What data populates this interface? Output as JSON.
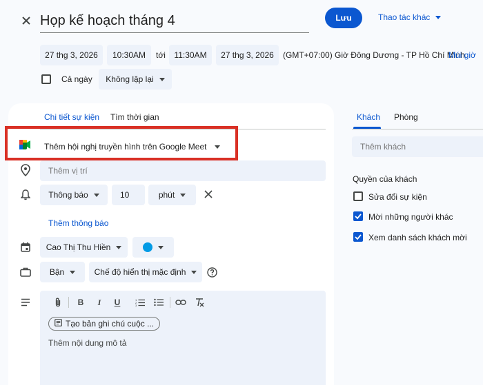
{
  "header": {
    "title": "Họp kế hoạch tháng 4",
    "save_label": "Lưu",
    "more_actions_label": "Thao tác khác"
  },
  "datetime": {
    "start_date": "27 thg 3, 2026",
    "start_time": "10:30AM",
    "to_label": "tới",
    "end_time": "11:30AM",
    "end_date": "27 thg 3, 2026",
    "timezone": "(GMT+07:00) Giờ Đông Dương - TP Hồ Chí Minh",
    "timezone_link": "Múi giờ",
    "all_day_label": "Cả ngày",
    "repeat_label": "Không lặp lại"
  },
  "details": {
    "tabs": [
      "Chi tiết sự kiện",
      "Tìm thời gian"
    ],
    "meet_label": "Thêm hội nghị truyền hình trên Google Meet",
    "location_placeholder": "Thêm vị trí",
    "notification_type": "Thông báo",
    "notification_value": "10",
    "notification_unit": "phút",
    "add_notification": "Thêm thông báo",
    "owner": "Cao Thị Thu Hiền",
    "event_color": "#039be5",
    "busy_status": "Bận",
    "visibility": "Chế độ hiển thị mặc định",
    "meeting_notes_label": "Tạo bản ghi chú cuộc ...",
    "description_placeholder": "Thêm nội dung mô tả"
  },
  "guests": {
    "tabs": [
      "Khách",
      "Phòng"
    ],
    "add_guests_placeholder": "Thêm khách",
    "permissions_title": "Quyền của khách",
    "permissions": [
      {
        "label": "Sửa đổi sự kiện",
        "checked": false
      },
      {
        "label": "Mời những người khác",
        "checked": true
      },
      {
        "label": "Xem danh sách khách mời",
        "checked": true
      }
    ]
  },
  "colors": {
    "primary": "#0b57d0",
    "highlight_box": "#d93025"
  }
}
